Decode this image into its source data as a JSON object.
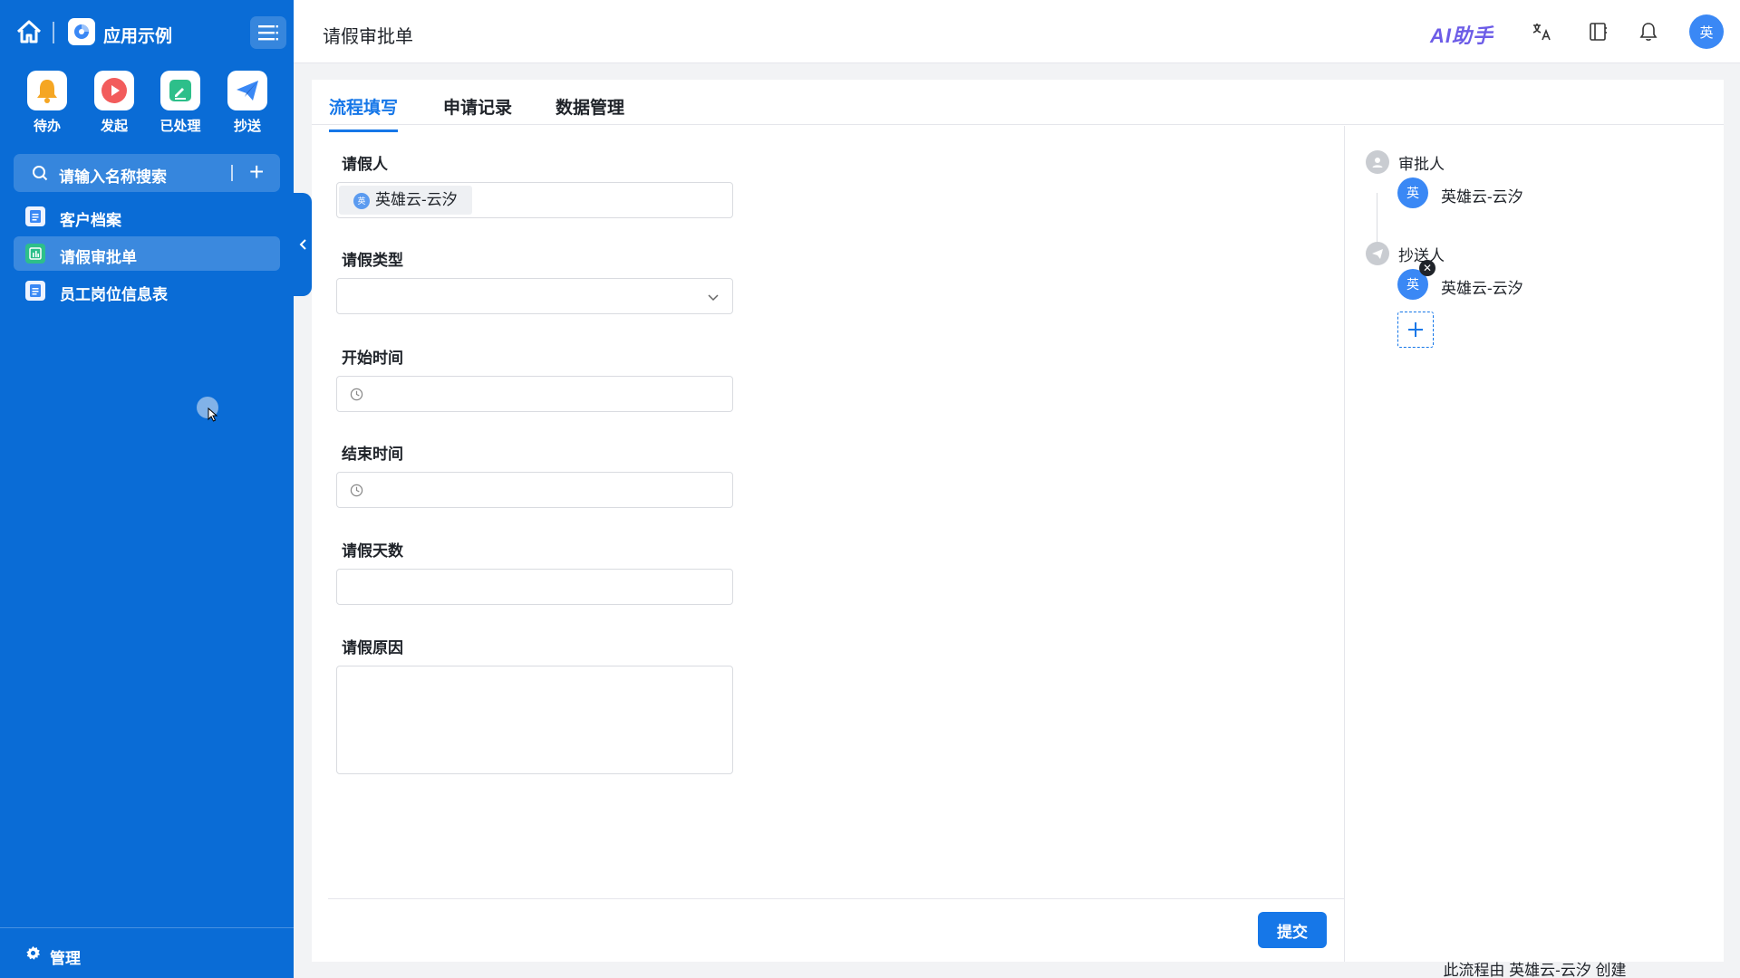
{
  "sidebar": {
    "app_name": "应用示例",
    "quick_actions": [
      {
        "label": "待办",
        "icon": "bell-icon",
        "color": "#f5a623"
      },
      {
        "label": "发起",
        "icon": "play-icon",
        "color": "#f25c5c"
      },
      {
        "label": "已处理",
        "icon": "edit-icon",
        "color": "#2dbf8a"
      },
      {
        "label": "抄送",
        "icon": "send-icon",
        "color": "#3a88f5"
      }
    ],
    "search_placeholder": "请输入名称搜索",
    "items": [
      {
        "label": "客户档案",
        "icon": "document-icon",
        "active": false
      },
      {
        "label": "请假审批单",
        "icon": "form-icon",
        "active": true
      },
      {
        "label": "员工岗位信息表",
        "icon": "document-icon",
        "active": false
      }
    ],
    "bottom_label": "管理"
  },
  "header": {
    "title": "请假审批单",
    "ai_label": "AI助手",
    "avatar_text": "英"
  },
  "tabs": [
    {
      "label": "流程填写",
      "active": true
    },
    {
      "label": "申请记录",
      "active": false
    },
    {
      "label": "数据管理",
      "active": false
    }
  ],
  "form": {
    "applicant_label": "请假人",
    "applicant_avatar": "英",
    "applicant_value": "英雄云-云汐",
    "type_label": "请假类型",
    "type_value": "",
    "start_label": "开始时间",
    "start_value": "",
    "end_label": "结束时间",
    "end_value": "",
    "days_label": "请假天数",
    "days_value": "",
    "reason_label": "请假原因",
    "reason_value": "",
    "submit_label": "提交"
  },
  "flow": {
    "approver_title": "审批人",
    "approver_avatar": "英",
    "approver_name": "英雄云-云汐",
    "cc_title": "抄送人",
    "cc_avatar": "英",
    "cc_name": "英雄云-云汐",
    "created_by": "此流程由 英雄云-云汐 创建"
  },
  "colors": {
    "sidebar_bg": "#0a6cd6",
    "accent": "#1677e8",
    "avatar_bg": "#3a88f5"
  }
}
